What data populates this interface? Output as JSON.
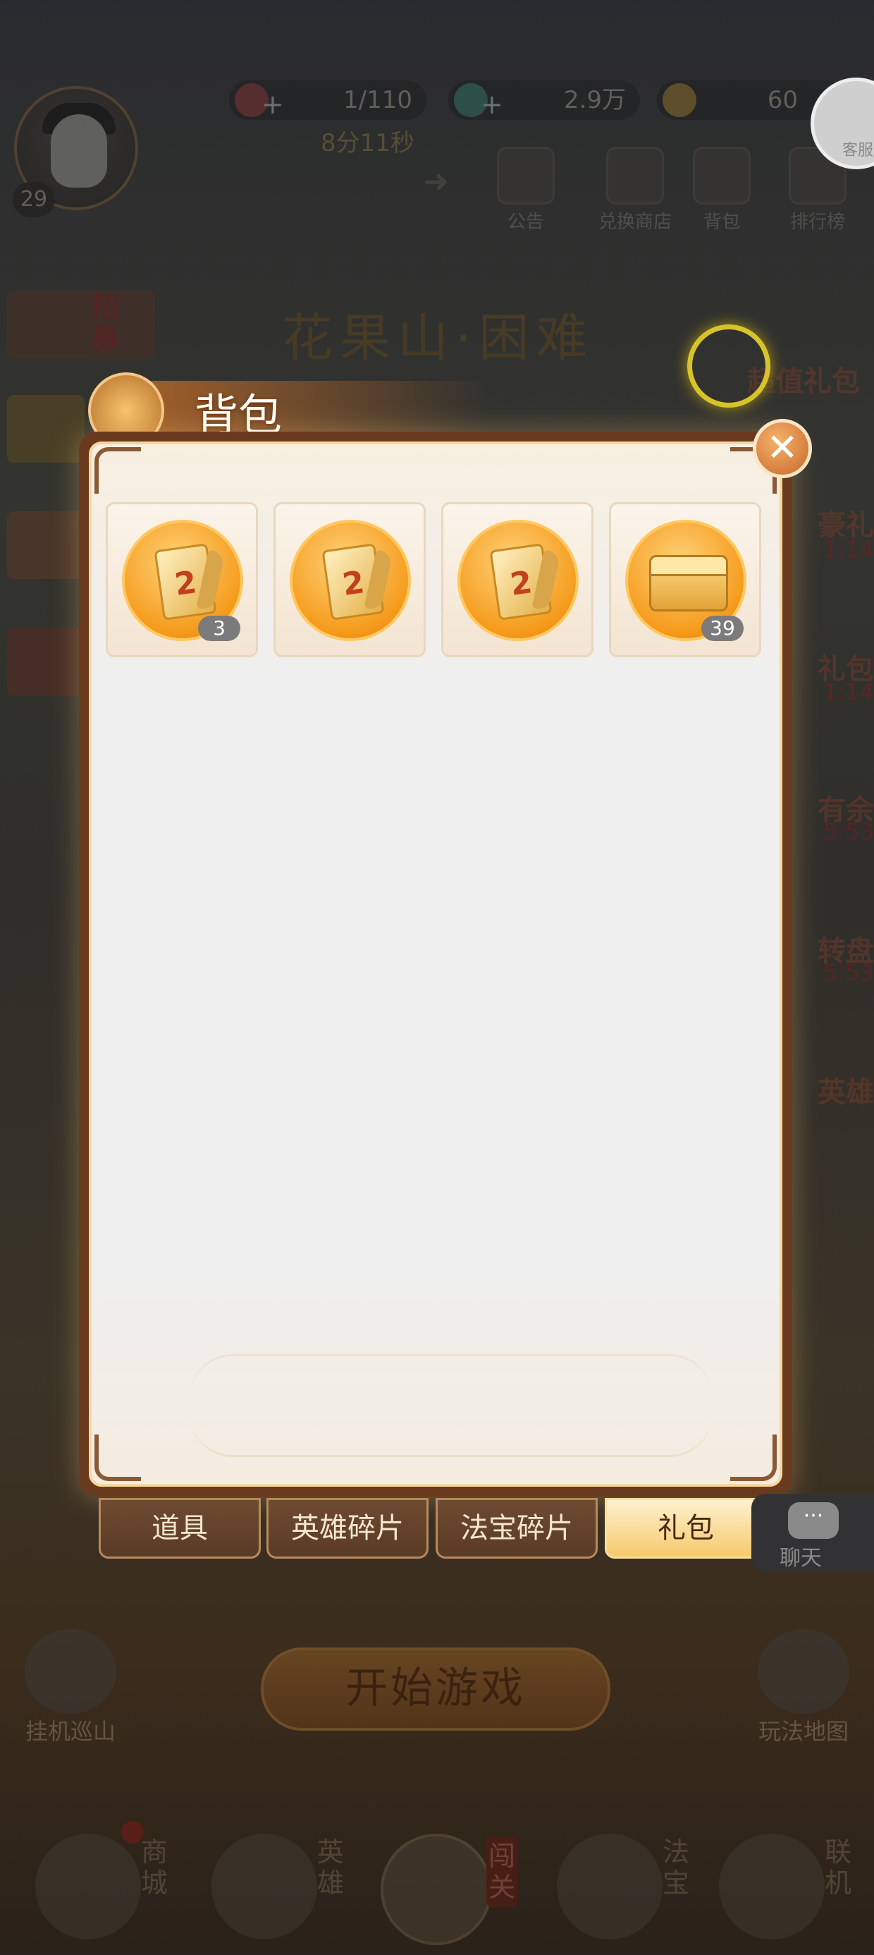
{
  "top_bar": {
    "level": "29",
    "stamina": "1/110",
    "stamina_timer": "8分11秒",
    "gems": "2.9万",
    "coins": "60",
    "support_label": "客服"
  },
  "nav_icons": [
    "公告",
    "兑换商店",
    "背包",
    "排行榜"
  ],
  "stage_title": "花果山·困难",
  "left_side": {
    "recruit": "招募"
  },
  "right_side": {
    "super_gift": "超值礼包",
    "items": [
      {
        "label": "豪礼",
        "timer": "1:14"
      },
      {
        "label": "礼包",
        "timer": "1:14"
      },
      {
        "label": "有余",
        "timer": "5:53"
      },
      {
        "label": "转盘",
        "timer": "5:53"
      },
      {
        "label": "英雄",
        "timer": ""
      }
    ]
  },
  "modal": {
    "title": "背包",
    "close_glyph": "✕",
    "items": [
      {
        "icon": "card-2-icon",
        "count": "3"
      },
      {
        "icon": "card-2-icon",
        "count": ""
      },
      {
        "icon": "card-2-icon",
        "count": ""
      },
      {
        "icon": "treasure-chest-icon",
        "count": "39"
      }
    ],
    "card_number": "2",
    "tabs": [
      "道具",
      "英雄碎片",
      "法宝碎片",
      "礼包"
    ],
    "active_tab": "礼包"
  },
  "chat": {
    "label": "聊天"
  },
  "start_button": "开始游戏",
  "corner_buttons": {
    "left": "挂机巡山",
    "right": "玩法地图"
  },
  "bottom_nav": [
    {
      "label": "商城"
    },
    {
      "label": "英雄"
    },
    {
      "label": "闯关"
    },
    {
      "label": "法宝"
    },
    {
      "label": "联机"
    }
  ]
}
